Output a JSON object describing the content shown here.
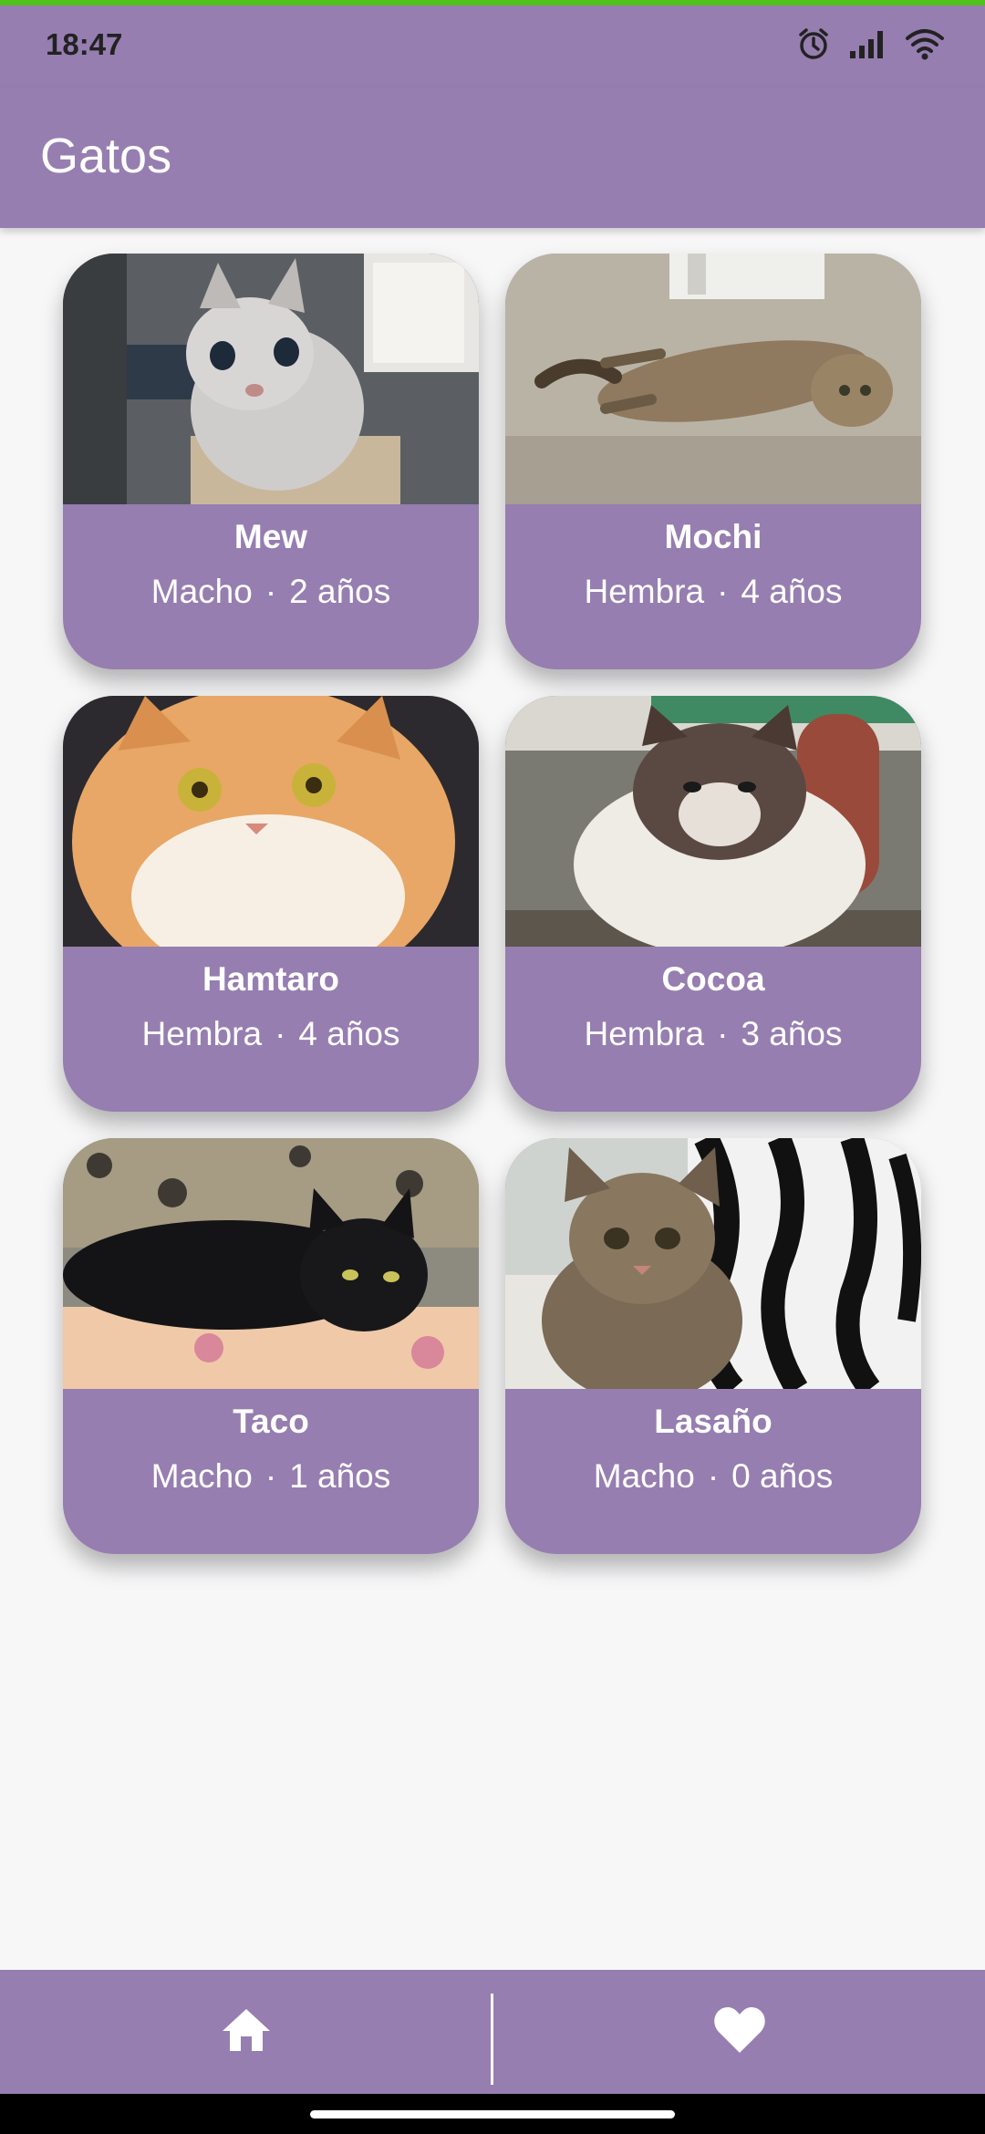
{
  "status_bar": {
    "time": "18:47",
    "icons": [
      "alarm-icon",
      "signal-icon",
      "wifi-icon"
    ]
  },
  "app_bar": {
    "title": "Gatos"
  },
  "cats": [
    {
      "name": "Mew",
      "sex": "Macho",
      "age": "2 años",
      "separator": "·",
      "photo": "cat-photo-mew"
    },
    {
      "name": "Mochi",
      "sex": "Hembra",
      "age": "4 años",
      "separator": "·",
      "photo": "cat-photo-mochi"
    },
    {
      "name": "Hamtaro",
      "sex": "Hembra",
      "age": "4 años",
      "separator": "·",
      "photo": "cat-photo-hamtaro"
    },
    {
      "name": "Cocoa",
      "sex": "Hembra",
      "age": "3 años",
      "separator": "·",
      "photo": "cat-photo-cocoa"
    },
    {
      "name": "Taco",
      "sex": "Macho",
      "age": "1 años",
      "separator": "·",
      "photo": "cat-photo-taco"
    },
    {
      "name": "Lasaño",
      "sex": "Macho",
      "age": "0 años",
      "separator": "·",
      "photo": "cat-photo-lasano"
    }
  ],
  "bottom_nav": {
    "items": [
      {
        "icon": "home-icon"
      },
      {
        "icon": "heart-icon"
      }
    ]
  },
  "colors": {
    "primary": "#967eb0",
    "background": "#f7f7f8",
    "on_primary": "#ffffff",
    "top_strip": "#4fc21b"
  }
}
